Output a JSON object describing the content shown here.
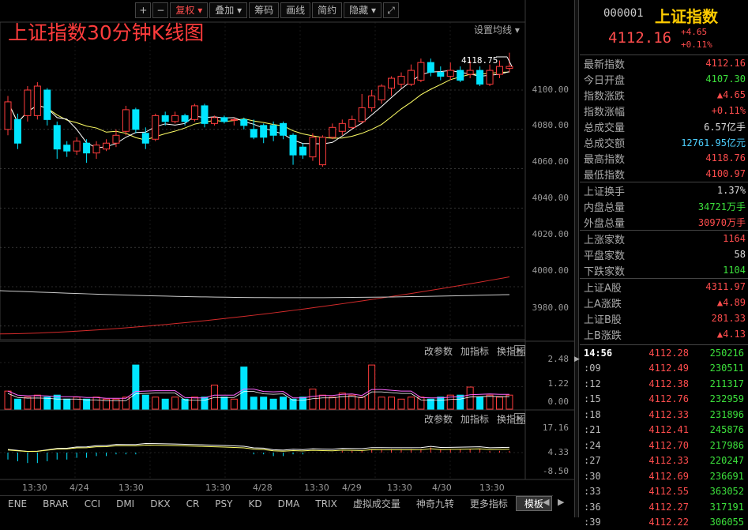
{
  "toolbar": {
    "plus": "+",
    "minus": "−",
    "fuquan": "复权",
    "diejia": "叠加",
    "chouma": "筹码",
    "huaxian": "画线",
    "jianjie": "简约",
    "yincang": "隐藏",
    "fullscreen_icon": "expand-icon"
  },
  "chart": {
    "title": "上证指数30分钟K线图",
    "setting_link": "设置均线",
    "last_price_label": "4118.75",
    "price_axis": [
      "4100.00",
      "4080.00",
      "4060.00",
      "4040.00",
      "4020.00",
      "4000.00",
      "3980.00"
    ],
    "vol_axis": [
      "2.48",
      "1.22",
      "0.00"
    ],
    "macd_axis": [
      "17.16",
      "4.33",
      "-8.50"
    ],
    "panel_buttons": {
      "modify": "改参数",
      "add": "加指标",
      "switch": "换指标",
      "close": "×"
    },
    "dates": [
      "13:30",
      "4/24",
      "13:30",
      "13:30",
      "4/28",
      "13:30",
      "4/29",
      "13:30",
      "4/30",
      "13:30"
    ],
    "colors": {
      "up": "#ff3c3c",
      "down": "#00e5ff",
      "ma5": "#ffffff",
      "ma10": "#ffff66",
      "ma_long_red": "#d42b2b",
      "ma_long_white": "#cccccc"
    }
  },
  "chart_data": {
    "type": "candlestick",
    "title": "上证指数30分钟K线图",
    "ylim": [
      3975,
      4125
    ],
    "candles": [
      {
        "o": 4080,
        "c": 4094,
        "h": 4097,
        "l": 4077
      },
      {
        "o": 4085,
        "c": 4073,
        "h": 4088,
        "l": 4070
      },
      {
        "o": 4087,
        "c": 4100,
        "h": 4102,
        "l": 4084
      },
      {
        "o": 4087,
        "c": 4102,
        "h": 4104,
        "l": 4085
      },
      {
        "o": 4100,
        "c": 4085,
        "h": 4101,
        "l": 4082
      },
      {
        "o": 4082,
        "c": 4070,
        "h": 4084,
        "l": 4065
      },
      {
        "o": 4072,
        "c": 4069,
        "h": 4074,
        "l": 4066
      },
      {
        "o": 4069,
        "c": 4074,
        "h": 4076,
        "l": 4067
      },
      {
        "o": 4073,
        "c": 4068,
        "h": 4075,
        "l": 4063
      },
      {
        "o": 4068,
        "c": 4072,
        "h": 4074,
        "l": 4065
      },
      {
        "o": 4070,
        "c": 4073,
        "h": 4075,
        "l": 4069
      },
      {
        "o": 4073,
        "c": 4077,
        "h": 4080,
        "l": 4071
      },
      {
        "o": 4079,
        "c": 4090,
        "h": 4092,
        "l": 4077
      },
      {
        "o": 4090,
        "c": 4080,
        "h": 4091,
        "l": 4078
      },
      {
        "o": 4078,
        "c": 4073,
        "h": 4081,
        "l": 4070
      },
      {
        "o": 4075,
        "c": 4087,
        "h": 4088,
        "l": 4074
      },
      {
        "o": 4087,
        "c": 4084,
        "h": 4089,
        "l": 4082
      },
      {
        "o": 4084,
        "c": 4087,
        "h": 4089,
        "l": 4083
      },
      {
        "o": 4087,
        "c": 4084,
        "h": 4088,
        "l": 4082
      },
      {
        "o": 4085,
        "c": 4092,
        "h": 4093,
        "l": 4084
      },
      {
        "o": 4092,
        "c": 4083,
        "h": 4093,
        "l": 4081
      },
      {
        "o": 4083,
        "c": 4086,
        "h": 4087,
        "l": 4082
      },
      {
        "o": 4086,
        "c": 4084,
        "h": 4087,
        "l": 4083
      },
      {
        "o": 4085,
        "c": 4085,
        "h": 4086,
        "l": 4082
      },
      {
        "o": 4085,
        "c": 4082,
        "h": 4086,
        "l": 4080
      },
      {
        "o": 4080,
        "c": 4076,
        "h": 4085,
        "l": 4075
      },
      {
        "o": 4082,
        "c": 4076,
        "h": 4083,
        "l": 4073
      },
      {
        "o": 4082,
        "c": 4077,
        "h": 4084,
        "l": 4074
      },
      {
        "o": 4083,
        "c": 4077,
        "h": 4084,
        "l": 4075
      },
      {
        "o": 4077,
        "c": 4067,
        "h": 4078,
        "l": 4062
      },
      {
        "o": 4071,
        "c": 4067,
        "h": 4073,
        "l": 4065
      },
      {
        "o": 4066,
        "c": 4076,
        "h": 4078,
        "l": 4064
      },
      {
        "o": 4062,
        "c": 4076,
        "h": 4077,
        "l": 4061
      },
      {
        "o": 4076,
        "c": 4081,
        "h": 4083,
        "l": 4075
      },
      {
        "o": 4079,
        "c": 4083,
        "h": 4085,
        "l": 4077
      },
      {
        "o": 4081,
        "c": 4085,
        "h": 4087,
        "l": 4080
      },
      {
        "o": 4084,
        "c": 4091,
        "h": 4098,
        "l": 4083
      },
      {
        "o": 4091,
        "c": 4097,
        "h": 4100,
        "l": 4089
      },
      {
        "o": 4095,
        "c": 4102,
        "h": 4103,
        "l": 4093
      },
      {
        "o": 4101,
        "c": 4106,
        "h": 4107,
        "l": 4097
      },
      {
        "o": 4103,
        "c": 4107,
        "h": 4109,
        "l": 4101
      },
      {
        "o": 4103,
        "c": 4110,
        "h": 4113,
        "l": 4102
      },
      {
        "o": 4105,
        "c": 4114,
        "h": 4116,
        "l": 4104
      },
      {
        "o": 4114,
        "c": 4109,
        "h": 4116,
        "l": 4107
      },
      {
        "o": 4109,
        "c": 4107,
        "h": 4112,
        "l": 4105
      },
      {
        "o": 4107,
        "c": 4110,
        "h": 4114,
        "l": 4105
      },
      {
        "o": 4110,
        "c": 4105,
        "h": 4112,
        "l": 4104
      },
      {
        "o": 4108,
        "c": 4110,
        "h": 4115,
        "l": 4106
      },
      {
        "o": 4110,
        "c": 4103,
        "h": 4112,
        "l": 4102
      },
      {
        "o": 4103,
        "c": 4110,
        "h": 4113,
        "l": 4102
      },
      {
        "o": 4108,
        "c": 4112,
        "h": 4115,
        "l": 4106
      },
      {
        "o": 4111,
        "c": 4112,
        "h": 4119,
        "l": 4109
      }
    ],
    "volume": [
      0.9,
      0.5,
      0.6,
      0.7,
      0.6,
      0.7,
      0.5,
      0.6,
      0.5,
      0.6,
      0.5,
      0.5,
      0.6,
      2.2,
      0.7,
      0.6,
      0.5,
      0.6,
      0.5,
      0.6,
      0.6,
      1.2,
      0.6,
      0.5,
      2.1,
      0.6,
      0.6,
      0.5,
      0.6,
      0.5,
      0.6,
      1.0,
      0.7,
      0.6,
      0.8,
      0.7,
      0.6,
      2.2,
      0.6,
      0.6,
      0.5,
      0.6,
      0.6,
      0.5,
      0.6,
      0.7,
      0.7,
      1.1,
      0.6,
      0.7,
      0.6,
      0.7
    ],
    "macd": [
      -4,
      -5,
      -6,
      -6,
      -5,
      -4,
      -4,
      -3,
      -3,
      -2,
      -2,
      -1,
      -1,
      -1,
      0,
      0,
      0,
      0,
      0,
      0,
      0,
      0,
      0,
      0,
      0,
      -1,
      -1,
      -2,
      -2,
      -1,
      -1,
      0,
      0,
      0,
      1,
      1,
      1,
      2,
      2,
      2,
      2,
      2,
      2,
      3,
      2,
      2,
      2,
      2,
      2,
      1,
      1,
      1
    ]
  },
  "quote": {
    "code": "000001",
    "name": "上证指数",
    "price": "4112.16",
    "change": "+4.65",
    "change_pct": "+0.11%",
    "rows": [
      {
        "label": "最新指数",
        "value": "4112.16",
        "color": "red"
      },
      {
        "label": "今日开盘",
        "value": "4107.30",
        "color": "green"
      },
      {
        "label": "指数涨跌",
        "value": "▲4.65",
        "color": "red"
      },
      {
        "label": "指数涨幅",
        "value": "+0.11%",
        "color": "red"
      },
      {
        "label": "总成交量",
        "value": "6.57亿手",
        "color": "white"
      },
      {
        "label": "总成交额",
        "value": "12761.95亿元",
        "color": "cyan"
      },
      {
        "label": "最高指数",
        "value": "4118.76",
        "color": "red"
      },
      {
        "label": "最低指数",
        "value": "4100.97",
        "color": "red"
      }
    ],
    "rows2": [
      {
        "label": "上证换手",
        "value": "1.37%",
        "color": "white"
      },
      {
        "label": "内盘总量",
        "value": "34721万手",
        "color": "green"
      },
      {
        "label": "外盘总量",
        "value": "30970万手",
        "color": "red"
      }
    ],
    "rows3": [
      {
        "label": "上涨家数",
        "value": "1164",
        "color": "red"
      },
      {
        "label": "平盘家数",
        "value": "58",
        "color": "white"
      },
      {
        "label": "下跌家数",
        "value": "1104",
        "color": "green"
      }
    ],
    "rows4": [
      {
        "label": "上证A股",
        "value": "4311.97",
        "color": "red"
      },
      {
        "label": "上A涨跌",
        "value": "▲4.89",
        "color": "red"
      },
      {
        "label": "上证B股",
        "value": "281.33",
        "color": "red"
      },
      {
        "label": "上B涨跌",
        "value": "▲4.13",
        "color": "red"
      }
    ],
    "ticks": [
      {
        "t": "14:56",
        "p": "4112.28",
        "v": "250216"
      },
      {
        "t": ":09",
        "p": "4112.49",
        "v": "230511"
      },
      {
        "t": ":12",
        "p": "4112.38",
        "v": "211317"
      },
      {
        "t": ":15",
        "p": "4112.76",
        "v": "232959"
      },
      {
        "t": ":18",
        "p": "4112.33",
        "v": "231896"
      },
      {
        "t": ":21",
        "p": "4112.41",
        "v": "245876"
      },
      {
        "t": ":24",
        "p": "4112.70",
        "v": "217986"
      },
      {
        "t": ":27",
        "p": "4112.33",
        "v": "220247"
      },
      {
        "t": ":30",
        "p": "4112.69",
        "v": "236691"
      },
      {
        "t": ":33",
        "p": "4112.55",
        "v": "363052"
      },
      {
        "t": ":36",
        "p": "4112.27",
        "v": "317191"
      },
      {
        "t": ":39",
        "p": "4112.22",
        "v": "306055"
      }
    ]
  },
  "bottom_tabs": [
    "ENE",
    "BRAR",
    "CCI",
    "DMI",
    "DKX",
    "CR",
    "PSY",
    "KD",
    "DMA",
    "TRIX",
    "虚拟成交量",
    "神奇九转",
    "更多指标",
    "模板"
  ],
  "nav": {
    "left": "◀",
    "right": "▶",
    "splitter": "▶"
  }
}
